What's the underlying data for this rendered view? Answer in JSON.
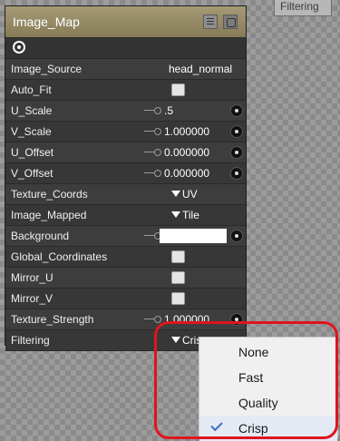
{
  "background_tab": "Filtering",
  "panel": {
    "title": "Image_Map",
    "icons": {
      "eye": "eye-icon",
      "menu": "menu-icon",
      "scroll": "scroll-icon"
    },
    "rows": [
      {
        "label": "Image_Source",
        "value": "head_normal"
      },
      {
        "label": "Auto_Fit",
        "value": ""
      },
      {
        "label": "U_Scale",
        "value": ".5"
      },
      {
        "label": "V_Scale",
        "value": "1.000000"
      },
      {
        "label": "U_Offset",
        "value": "0.000000"
      },
      {
        "label": "V_Offset",
        "value": "0.000000"
      },
      {
        "label": "Texture_Coords",
        "value": "UV"
      },
      {
        "label": "Image_Mapped",
        "value": "Tile"
      },
      {
        "label": "Background",
        "value": ""
      },
      {
        "label": "Global_Coordinates",
        "value": ""
      },
      {
        "label": "Mirror_U",
        "value": ""
      },
      {
        "label": "Mirror_V",
        "value": ""
      },
      {
        "label": "Texture_Strength",
        "value": "1.000000"
      },
      {
        "label": "Filtering",
        "value": "Crisp"
      }
    ]
  },
  "filter_menu": {
    "options": [
      "None",
      "Fast",
      "Quality",
      "Crisp"
    ],
    "selected": "Crisp"
  },
  "colors": {
    "highlight": "#e0141e",
    "check": "#3a6fc4",
    "titlebar": "#9a8f69"
  }
}
